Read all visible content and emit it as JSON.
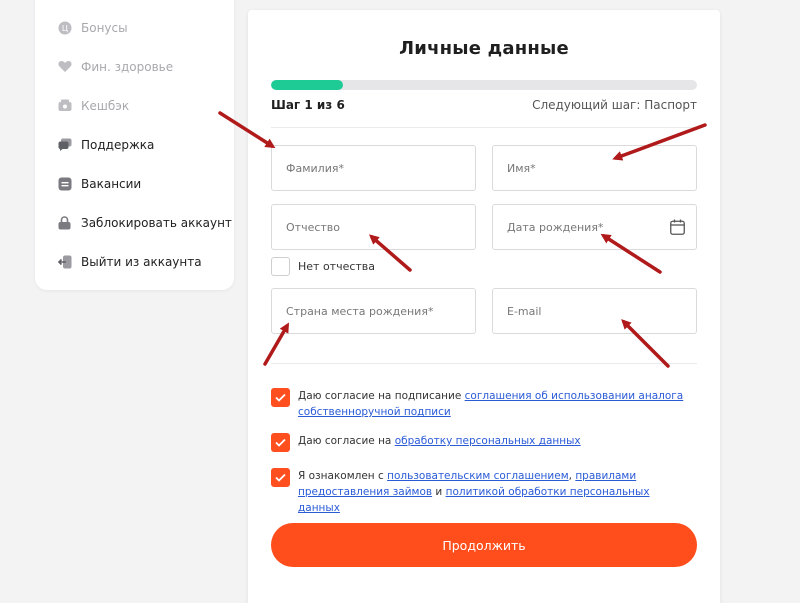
{
  "sidebar": {
    "items": [
      {
        "label": "Бонусы",
        "icon": "bonus-icon"
      },
      {
        "label": "Фин. здоровье",
        "icon": "heart-icon"
      },
      {
        "label": "Кешбэк",
        "icon": "cashback-icon"
      },
      {
        "label": "Поддержка",
        "icon": "chat-icon"
      },
      {
        "label": "Вакансии",
        "icon": "briefcase-icon"
      },
      {
        "label": "Заблокировать аккаунт",
        "icon": "lock-icon"
      },
      {
        "label": "Выйти из аккаунта",
        "icon": "logout-icon"
      }
    ]
  },
  "form": {
    "title": "Личные данные",
    "progress_percent": 17,
    "step_text": "Шаг 1 из 6",
    "next_step": "Следующий шаг: Паспорт",
    "fields": {
      "last_name": "Фамилия*",
      "first_name": "Имя*",
      "patronymic": "Отчество",
      "birth_date": "Дата рождения*",
      "birth_country": "Страна места рождения*",
      "email": "E-mail"
    },
    "no_patronymic": "Нет отчества",
    "consent1": {
      "text": "Даю согласие на подписание ",
      "link": "соглашения об использовании аналога собственноручной подписи"
    },
    "consent2": {
      "text": "Даю согласие на ",
      "link": "обработку персональных данных"
    },
    "consent3": {
      "text": "Я ознакомлен с ",
      "link1": "пользовательским соглашением",
      "sep1": ", ",
      "link2": "правилами предоставления займов",
      "sep2": " и ",
      "link3": "политикой обработки персональных данных"
    },
    "submit": "Продолжить"
  },
  "colors": {
    "accent": "#ff4d1c",
    "progress": "#1fcb95",
    "link": "#2a5bd7",
    "arrow": "#b01a1a"
  }
}
